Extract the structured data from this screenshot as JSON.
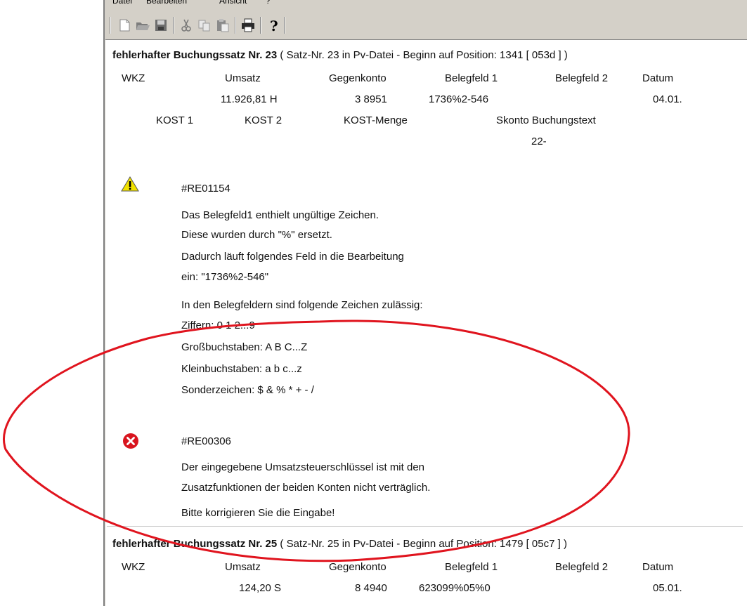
{
  "menu": {
    "items": [
      "Datei",
      "Bearbeiten",
      "Ansicht",
      "?"
    ]
  },
  "toolbar": {
    "buttons": [
      "new-document-icon",
      "open-folder-icon",
      "save-icon",
      "cut-icon",
      "copy-icon",
      "paste-icon",
      "print-icon",
      "help-icon"
    ],
    "help_glyph": "?"
  },
  "record1": {
    "title_bold": "fehlerhafter Buchungssatz Nr. 23",
    "title_rest": " ( Satz-Nr. 23 in Pv-Datei - Beginn auf Position: 1341 [ 053d ] )",
    "headers": {
      "wkz": "WKZ",
      "umsatz": "Umsatz",
      "gegenkonto": "Gegenkonto",
      "belegfeld1": "Belegfeld 1",
      "belegfeld2": "Belegfeld 2",
      "datum": "Datum"
    },
    "values": {
      "umsatz": "11.926,81 H",
      "gegenkonto": "3 8951",
      "belegfeld1": "1736%2-546",
      "datum": "04.01."
    },
    "headers2": {
      "kost1": "KOST 1",
      "kost2": "KOST 2",
      "kostmenge": "KOST-Menge",
      "skonto": "Skonto Buchungstext"
    },
    "values2": {
      "buchungstext": "22-"
    }
  },
  "warning": {
    "code": "#RE01154",
    "lines": [
      "Das Belegfeld1 enthielt ungültige Zeichen.",
      "Diese wurden durch \"%\" ersetzt.",
      "Dadurch läuft folgendes Feld in die Bearbeitung",
      "ein: \"1736%2-546\"",
      "In den Belegfeldern sind folgende Zeichen zulässig:",
      "Ziffern: 0 1 2...9",
      "Großbuchstaben: A B C...Z",
      "Kleinbuchstaben: a b c...z",
      "Sonderzeichen: $ & % * + - /"
    ]
  },
  "error": {
    "code": "#RE00306",
    "lines": [
      "Der eingegebene Umsatzsteuerschlüssel ist mit den",
      "Zusatzfunktionen der beiden Konten nicht verträglich.",
      "Bitte korrigieren Sie die Eingabe!"
    ]
  },
  "record2": {
    "title_bold": "fehlerhafter Buchungssatz Nr. 25",
    "title_rest": " ( Satz-Nr. 25 in Pv-Datei - Beginn auf Position: 1479 [ 05c7 ] )",
    "headers": {
      "wkz": "WKZ",
      "umsatz": "Umsatz",
      "gegenkonto": "Gegenkonto",
      "belegfeld1": "Belegfeld 1",
      "belegfeld2": "Belegfeld 2",
      "datum": "Datum"
    },
    "values": {
      "umsatz": "124,20 S",
      "gegenkonto": "8 4940",
      "belegfeld1": "623099%05%0",
      "datum": "05.01."
    }
  },
  "colors": {
    "annotation": "#e0141e",
    "warning": "#f2e200",
    "error": "#d9141e",
    "toolbar": "#d4d0c8"
  }
}
